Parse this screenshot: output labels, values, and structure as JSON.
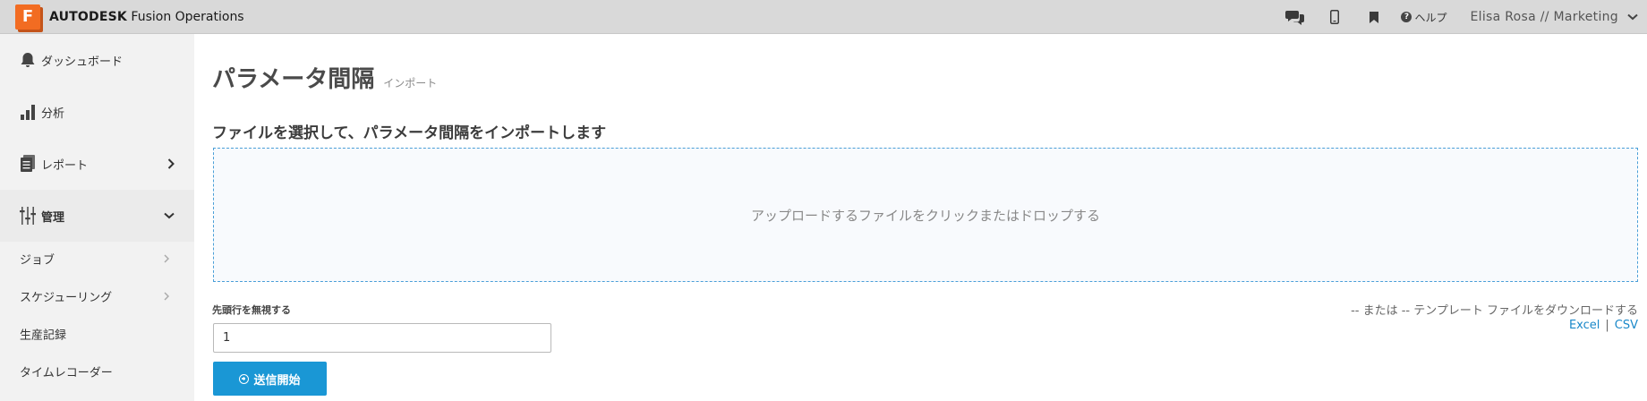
{
  "header": {
    "logo_letter": "F",
    "brand_bold": "AUTODESK",
    "brand_rest": "Fusion Operations",
    "help_label": "ヘルプ",
    "user_label": "Elisa Rosa // Marketing",
    "icons": [
      "chat-icon",
      "mobile-icon",
      "bookmark-icon",
      "help-icon",
      "chevron-down-icon"
    ]
  },
  "sidebar": {
    "items": [
      {
        "label": "ダッシュボード",
        "icon": "bell-icon"
      },
      {
        "label": "分析",
        "icon": "bar-chart-icon"
      },
      {
        "label": "レポート",
        "icon": "document-stack-icon"
      },
      {
        "label": "管理",
        "icon": "sliders-icon"
      }
    ],
    "sub_items": [
      {
        "label": "ジョブ"
      },
      {
        "label": "スケジューリング"
      },
      {
        "label": "生産記録"
      },
      {
        "label": "タイムレコーダー"
      }
    ]
  },
  "main": {
    "title": "パラメータ間隔",
    "subtitle": "インポート",
    "section_label": "ファイルを選択して、パラメータ間隔をインポートします",
    "dropzone_text": "アップロードするファイルをクリックまたはドロップする",
    "skip_label": "先頭行を無視する",
    "skip_value": "1",
    "template_text": "-- または -- テンプレート ファイルをダウンロードする",
    "excel_link": "Excel",
    "separator": "|",
    "csv_link": "CSV",
    "submit_label": "送信開始"
  },
  "colors": {
    "accent": "#1a97d5",
    "brand": "#f26c22",
    "link": "#1a88c9",
    "topbar": "#d9d9d9",
    "sidebar": "#f2f2f2"
  }
}
